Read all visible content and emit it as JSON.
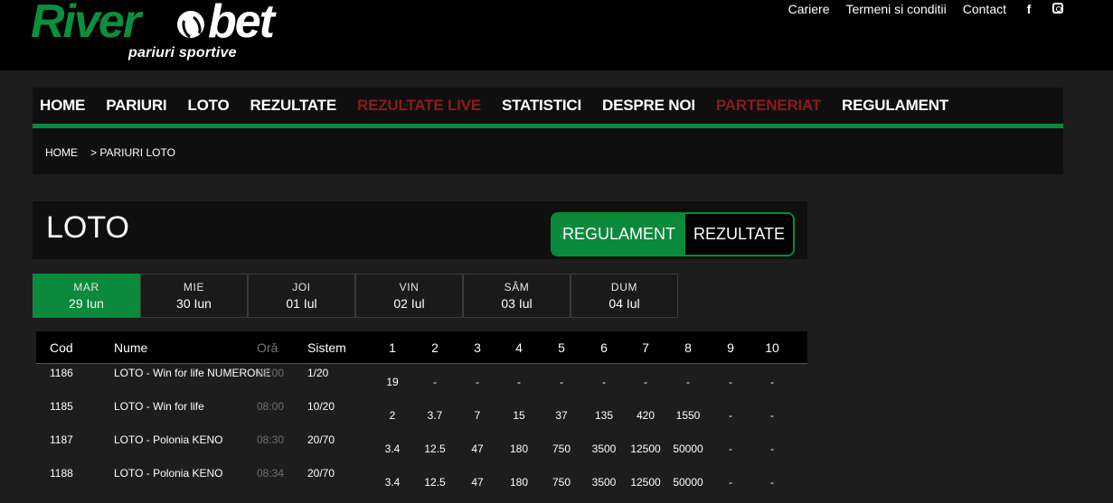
{
  "brand": {
    "name_part1": "River",
    "name_part2": "bet",
    "tagline": "pariuri sportive",
    "green": "#0a8a3a",
    "red": "#8c1b1b"
  },
  "toplinks": [
    {
      "label": "Cariere"
    },
    {
      "label": "Termeni si conditii"
    },
    {
      "label": "Contact"
    }
  ],
  "social": {
    "facebook_glyph": "f",
    "facebook_icon": "facebook-icon",
    "instagram_icon": "instagram-icon"
  },
  "nav": [
    {
      "label": "HOME"
    },
    {
      "label": "PARIURI"
    },
    {
      "label": "LOTO"
    },
    {
      "label": "REZULTATE"
    },
    {
      "label": "REZULTATE LIVE"
    },
    {
      "label": "STATISTICI"
    },
    {
      "label": "DESPRE NOI"
    },
    {
      "label": "PARTENERIAT"
    },
    {
      "label": "REGULAMENT"
    }
  ],
  "breadcrumb": {
    "home": "HOME",
    "current": "> PARIURI LOTO"
  },
  "page": {
    "title": "LOTO",
    "btn_regulament": "REGULAMENT",
    "btn_rezultate": "REZULTATE"
  },
  "days": [
    {
      "name": "MAR",
      "date": "29 Iun"
    },
    {
      "name": "MIE",
      "date": "30 Iun"
    },
    {
      "name": "JOI",
      "date": "01 Iul"
    },
    {
      "name": "VIN",
      "date": "02 Iul"
    },
    {
      "name": "SÂM",
      "date": "03 Iul"
    },
    {
      "name": "DUM",
      "date": "04 Iul"
    }
  ],
  "table": {
    "headers": {
      "cod": "Cod",
      "nume": "Nume",
      "ora": "Oră",
      "sistem": "Sistem"
    },
    "num_headers": [
      "1",
      "2",
      "3",
      "4",
      "5",
      "6",
      "7",
      "8",
      "9",
      "10"
    ],
    "rows": [
      {
        "cod": "1186",
        "nume": "LOTO - Win for life NUMERONE",
        "ora": "08:00",
        "sistem": "1/20",
        "vals": [
          "19",
          "-",
          "-",
          "-",
          "-",
          "-",
          "-",
          "-",
          "-",
          "-"
        ]
      },
      {
        "cod": "1185",
        "nume": "LOTO - Win for life",
        "ora": "08:00",
        "sistem": "10/20",
        "vals": [
          "2",
          "3.7",
          "7",
          "15",
          "37",
          "135",
          "420",
          "1550",
          "-",
          "-"
        ]
      },
      {
        "cod": "1187",
        "nume": "LOTO - Polonia KENO",
        "ora": "08:30",
        "sistem": "20/70",
        "vals": [
          "3.4",
          "12.5",
          "47",
          "180",
          "750",
          "3500",
          "12500",
          "50000",
          "-",
          "-"
        ]
      },
      {
        "cod": "1188",
        "nume": "LOTO - Polonia KENO",
        "ora": "08:34",
        "sistem": "20/70",
        "vals": [
          "3.4",
          "12.5",
          "47",
          "180",
          "750",
          "3500",
          "12500",
          "50000",
          "-",
          "-"
        ]
      }
    ]
  }
}
